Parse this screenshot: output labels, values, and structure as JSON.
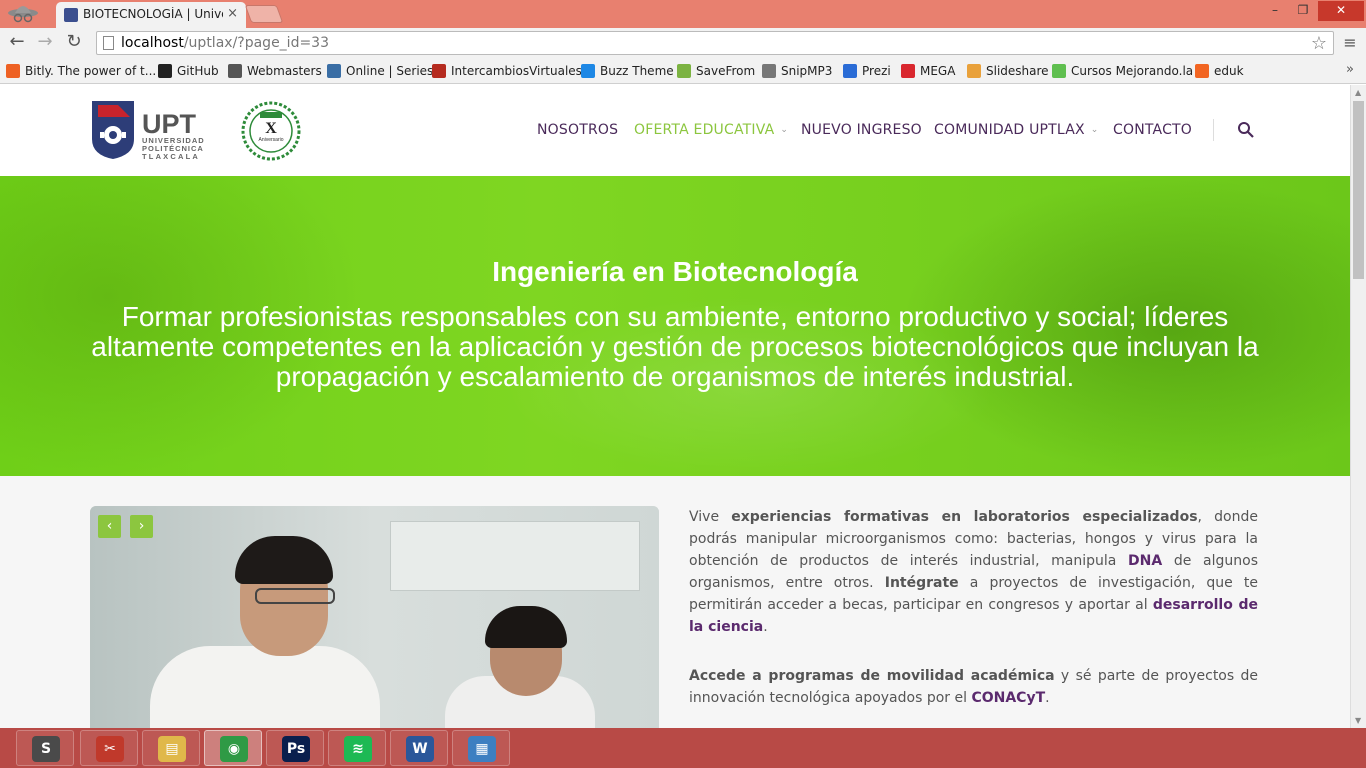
{
  "browser": {
    "tab_title": "BIOTECNOLOGÍA | Univers",
    "tab_close": "×",
    "url_host": "localhost",
    "url_path": "/uptlax/?page_id=33",
    "window_controls": {
      "minimize": "–",
      "maximize": "❐",
      "close": "✕"
    }
  },
  "bookmarks": [
    {
      "label": "Bitly. The power of t...",
      "icon": "bitly-icon",
      "color": "#ee6123"
    },
    {
      "label": "GitHub",
      "icon": "github-icon",
      "color": "#222222"
    },
    {
      "label": "Webmasters",
      "icon": "webmasters-icon",
      "color": "#555555"
    },
    {
      "label": "Online | Series",
      "icon": "series-icon",
      "color": "#3a6ea5"
    },
    {
      "label": "IntercambiosVirtuales",
      "icon": "iv-icon",
      "color": "#b52b1f"
    },
    {
      "label": "Buzz Theme",
      "icon": "buzz-icon",
      "color": "#1e88e5"
    },
    {
      "label": "SaveFrom",
      "icon": "savefrom-icon",
      "color": "#7cb342"
    },
    {
      "label": "SnipMP3",
      "icon": "snipmp3-icon",
      "color": "#777777"
    },
    {
      "label": "Prezi",
      "icon": "prezi-icon",
      "color": "#2a6cd6"
    },
    {
      "label": "MEGA",
      "icon": "mega-icon",
      "color": "#d9272e"
    },
    {
      "label": "Slideshare",
      "icon": "slideshare-icon",
      "color": "#e9a13b"
    },
    {
      "label": "Cursos Mejorando.la",
      "icon": "mejorando-icon",
      "color": "#5fbf4f"
    },
    {
      "label": "eduk",
      "icon": "eduk-icon",
      "color": "#f26522"
    }
  ],
  "site": {
    "logo_text": "UPT",
    "logo_sub1": "UNIVERSIDAD",
    "logo_sub2": "POLITÉCNICA",
    "logo_sub3": "TLAXCALA",
    "anniv_mark": "X",
    "anniv_text": "Aniversario",
    "nav": [
      {
        "label": "NOSOTROS",
        "dropdown": false,
        "active": false
      },
      {
        "label": "OFERTA EDUCATIVA",
        "dropdown": true,
        "active": true
      },
      {
        "label": "NUEVO INGRESO",
        "dropdown": false,
        "active": false
      },
      {
        "label": "COMUNIDAD UPTLAX",
        "dropdown": true,
        "active": false
      },
      {
        "label": "CONTACTO",
        "dropdown": false,
        "active": false
      }
    ],
    "accent_color": "#8cc63f",
    "nav_color": "#4a2a5a"
  },
  "hero": {
    "title": "Ingeniería en Biotecnología",
    "subtitle": "Formar profesionistas responsables con su ambiente, entorno productivo y social; líderes altamente competentes en la aplicación y gestión de procesos biotecnológicos que incluyan la propagación y escalamiento de organismos de interés industrial."
  },
  "slider": {
    "prev": "‹",
    "next": "›"
  },
  "article": {
    "p1": {
      "t1": "Vive ",
      "b1": "experiencias formativas en laboratorios especializados",
      "t2": ", donde podrás manipular microorganismos como: bacterias, hongos y virus para la obtención de productos de interés industrial, manipula ",
      "h1": "DNA",
      "t3": " de algunos organismos, entre otros. ",
      "b2": "Intégrate",
      "t4": " a proyectos de investigación, que te permitirán acceder a becas, participar en congresos y aportar al ",
      "h2": "desarrollo de la ciencia",
      "t5": "."
    },
    "p2": {
      "b1": "Accede a programas de movilidad académica",
      "t1": " y sé parte de proyectos de innovación tecnológica apoyados por el ",
      "h1": "CONACyT",
      "t2": "."
    }
  },
  "taskbar": [
    {
      "name": "sublime-text-icon",
      "glyph": "S",
      "color": "#4a4a4a"
    },
    {
      "name": "snipping-tool-icon",
      "glyph": "✂",
      "color": "#c0392b"
    },
    {
      "name": "file-explorer-icon",
      "glyph": "▤",
      "color": "#e0b84a"
    },
    {
      "name": "chrome-icon",
      "glyph": "◉",
      "color": "#2f9a45",
      "active": true
    },
    {
      "name": "photoshop-icon",
      "glyph": "Ps",
      "color": "#0a1f4d"
    },
    {
      "name": "spotify-icon",
      "glyph": "≋",
      "color": "#1db954"
    },
    {
      "name": "word-icon",
      "glyph": "W",
      "color": "#2b579a"
    },
    {
      "name": "control-panel-icon",
      "glyph": "▦",
      "color": "#3d7fc1"
    }
  ]
}
